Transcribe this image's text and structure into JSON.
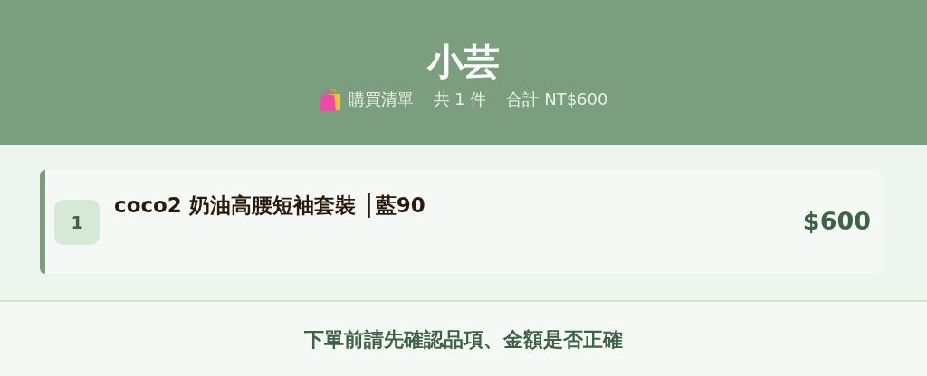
{
  "header": {
    "title": "小芸",
    "subtitle": {
      "list_label": "購買清單",
      "count": "共 1 件",
      "total": "合計 NT$600"
    }
  },
  "items": [
    {
      "index": "1",
      "name": "coco2 奶油高腰短袖套裝 │藍90",
      "price": "$600"
    }
  ],
  "footer": {
    "note": "下單前請先確認品項、金額是否正確"
  }
}
